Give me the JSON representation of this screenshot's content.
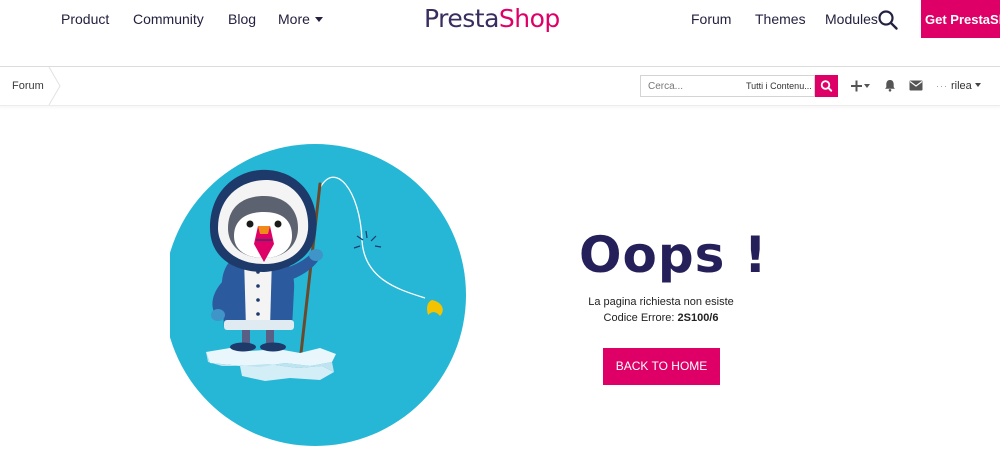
{
  "topnav": {
    "links": [
      "Product",
      "Community",
      "Blog",
      "More"
    ],
    "right_links": [
      "Forum",
      "Themes",
      "Modules"
    ],
    "logo": {
      "part1": "Presta",
      "part2": "Shop"
    },
    "cta_label": "Get PrestaSh",
    "search_icon": "search-icon"
  },
  "subbar": {
    "breadcrumb": "Forum",
    "search_placeholder": "Cerca...",
    "search_scope": "Tutti i Contenu...",
    "icons": [
      "search-icon",
      "plus-icon",
      "bell-icon",
      "envelope-icon"
    ],
    "user_name": "rilea"
  },
  "error": {
    "title": "Oops !",
    "message": "La pagina richiesta non esiste",
    "code_label": "Codice Errore:",
    "code": "2S100/6",
    "button_label": "BACK TO HOME"
  },
  "colors": {
    "brand_pink": "#df0067",
    "brand_navy": "#25205a",
    "circle_blue": "#26b6d6"
  }
}
